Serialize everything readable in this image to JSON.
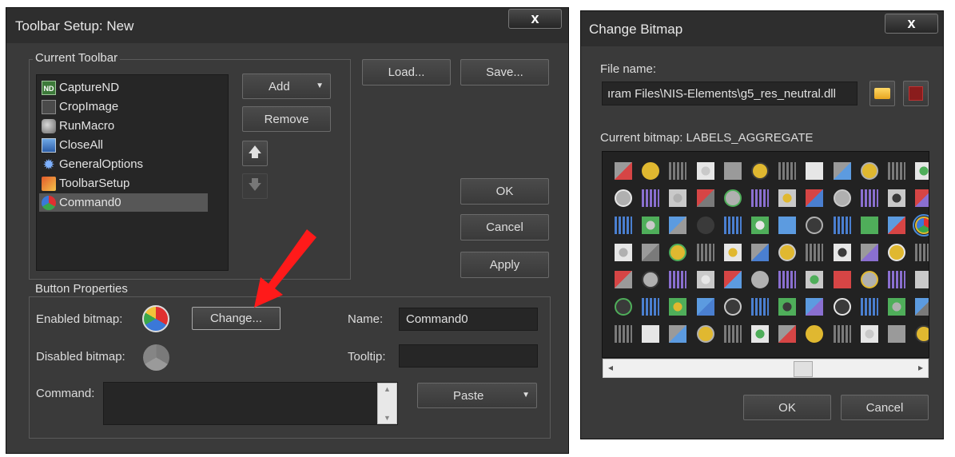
{
  "toolbar_setup": {
    "title": "Toolbar Setup: New",
    "close_label": "x",
    "current_toolbar_label": "Current Toolbar",
    "items": [
      {
        "label": "CaptureND",
        "icon": "capture-nd-icon",
        "selected": false
      },
      {
        "label": "CropImage",
        "icon": "crop-image-icon",
        "selected": false
      },
      {
        "label": "RunMacro",
        "icon": "run-macro-icon",
        "selected": false
      },
      {
        "label": "CloseAll",
        "icon": "close-all-icon",
        "selected": false
      },
      {
        "label": "GeneralOptions",
        "icon": "gear-icon",
        "selected": false
      },
      {
        "label": "ToolbarSetup",
        "icon": "toolbar-setup-icon",
        "selected": false
      },
      {
        "label": "Command0",
        "icon": "aggregate-labels-icon",
        "selected": true
      }
    ],
    "add_label": "Add",
    "remove_label": "Remove",
    "load_label": "Load...",
    "save_label": "Save...",
    "ok_label": "OK",
    "cancel_label": "Cancel",
    "apply_label": "Apply",
    "button_properties_label": "Button Properties",
    "enabled_bitmap_label": "Enabled bitmap:",
    "disabled_bitmap_label": "Disabled bitmap:",
    "change_label": "Change...",
    "name_label": "Name:",
    "name_value": "Command0",
    "tooltip_label": "Tooltip:",
    "tooltip_value": "",
    "command_label": "Command:",
    "command_value": "",
    "paste_label": "Paste"
  },
  "change_bitmap": {
    "title": "Change Bitmap",
    "close_label": "x",
    "file_name_label": "File name:",
    "file_name_value": "ıram Files\\NIS-Elements\\g5_res_neutral.dll",
    "current_bitmap_label": "Current bitmap: LABELS_AGGREGATE",
    "ok_label": "OK",
    "cancel_label": "Cancel",
    "scroll_left": "◂",
    "scroll_right": "▸"
  },
  "colors": {
    "window_bg": "#3a3a3a",
    "field_bg": "#262626",
    "selection": "#555555",
    "arrow": "#ff1a1a",
    "grid_selection": "#4a8ad8"
  }
}
